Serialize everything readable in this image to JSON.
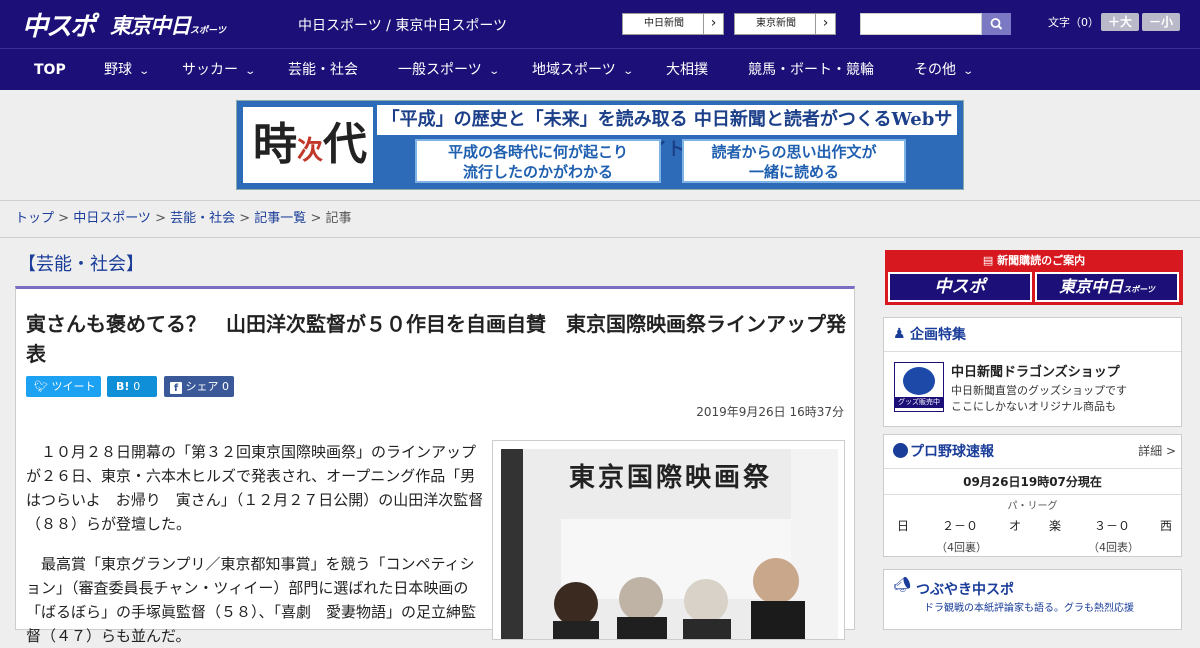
{
  "header": {
    "logo_main": "中スポ",
    "logo_tokyo": "東京中日",
    "logo_tokyo_sub": "スポーツ",
    "site_names": "中日スポーツ / 東京中日スポーツ",
    "paper_buttons": [
      "中日新聞",
      "東京新聞"
    ],
    "font_size_label": "文字（0）",
    "font_plus": "＋大",
    "font_minus": "－小"
  },
  "nav": {
    "items": [
      {
        "label": "TOP",
        "dropdown": false
      },
      {
        "label": "野球",
        "dropdown": true
      },
      {
        "label": "サッカー",
        "dropdown": true
      },
      {
        "label": "芸能・社会",
        "dropdown": false
      },
      {
        "label": "一般スポーツ",
        "dropdown": true
      },
      {
        "label": "地域スポーツ",
        "dropdown": true
      },
      {
        "label": "大相撲",
        "dropdown": false
      },
      {
        "label": "競馬・ボート・競輪",
        "dropdown": false
      },
      {
        "label": "その他",
        "dropdown": true
      }
    ]
  },
  "banner": {
    "kanji_left": "時",
    "kanji_small": "次",
    "kanji_right": "代",
    "headline": "「平成」の歴史と「未来」を読み取る 中日新聞と読者がつくるWebサイト",
    "box1": [
      "平成の各時代に何が起こり",
      "流行したのかがわかる"
    ],
    "box2": [
      "読者からの思い出作文が",
      "一緒に読める"
    ]
  },
  "breadcrumb": {
    "items": [
      "トップ",
      "中日スポーツ",
      "芸能・社会",
      "記事一覧"
    ],
    "current": "記事"
  },
  "article": {
    "category": "【芸能・社会】",
    "title": "寅さんも褒めてる？　山田洋次監督が５０作目を自画自賛　東京国際映画祭ラインアップ発表",
    "tweet_label": "ツイート",
    "hatena_label": "B!",
    "hatena_count": "0",
    "share_label": "シェア",
    "share_count": "0",
    "date": "2019年9月26日 16時37分",
    "paragraph1": "１０月２８日開幕の「第３２回東京国際映画祭」のラインアップが２６日、東京・六本木ヒルズで発表され、オープニング作品「男はつらいよ　お帰り　寅さん」（１２月２７日公開）の山田洋次監督（８８）らが登壇した。",
    "paragraph2": "最高賞「東京グランプリ／東京都知事賞」を競う「コンペティション」（審査委員長チャン・ツィイー）部門に選ばれた日本映画の「ばるぼら」の手塚眞監督（５８）、「喜劇　愛妻物語」の足立紳監督（４７）らも並んだ。",
    "photo_sign": "東京国際映画祭"
  },
  "sidebar": {
    "subscribe_label": "新聞購読のご案内",
    "subscribe_a": "中スポ",
    "subscribe_b": "東京中日",
    "subscribe_b_small": "スポーツ",
    "feature_title": "企画特集",
    "feature_item_title": "中日新聞ドラゴンズショップ",
    "feature_item_desc1": "中日新聞直営のグッズショップです",
    "feature_item_desc2": "ここにしかないオリジナル商品も",
    "feature_badge": "グッズ販売中",
    "baseball_title": "プロ野球速報",
    "baseball_more": "詳細 >",
    "baseball_time": "09月26日19時07分現在",
    "baseball_league": "パ・リーグ",
    "games": [
      {
        "home": "日",
        "score": "２－０",
        "away": "オ",
        "inning": "（4回裏）"
      },
      {
        "home": "楽",
        "score": "３－０",
        "away": "西",
        "inning": "（4回表）"
      }
    ],
    "tweet_title": "つぶやき中スポ",
    "tweet_sub": "ドラ観戦の本紙評論家も語る。グラも熱烈応援"
  }
}
